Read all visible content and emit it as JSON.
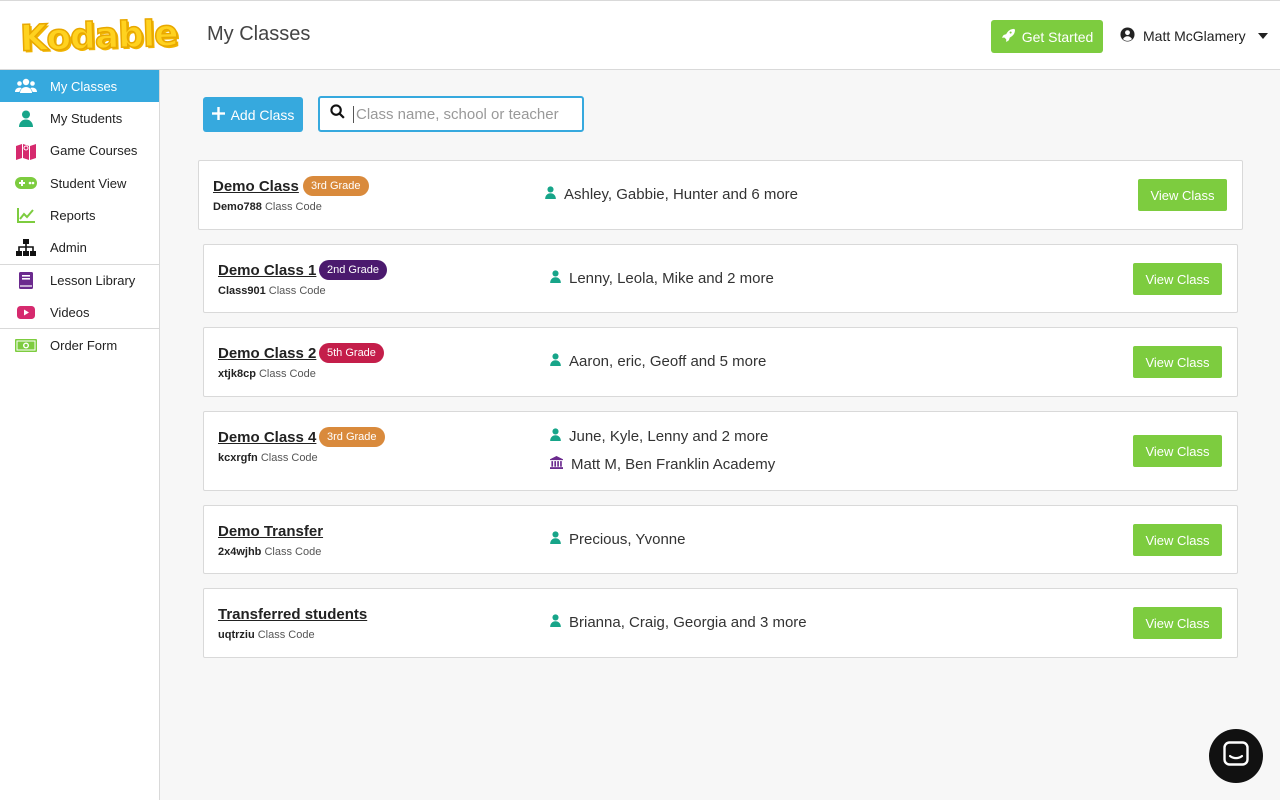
{
  "header": {
    "logo": "Kodable",
    "title": "My Classes",
    "get_started": "Get Started",
    "user_name": "Matt McGlamery"
  },
  "sidebar": {
    "items": [
      {
        "label": "My Classes",
        "icon": "users-icon",
        "active": true
      },
      {
        "label": "My Students",
        "icon": "user-icon"
      },
      {
        "label": "Game Courses",
        "icon": "map-icon"
      },
      {
        "label": "Student View",
        "icon": "gamepad-icon"
      },
      {
        "label": "Reports",
        "icon": "chart-line-icon"
      },
      {
        "label": "Admin",
        "icon": "sitemap-icon"
      },
      {
        "label": "Lesson Library",
        "icon": "book-icon"
      },
      {
        "label": "Videos",
        "icon": "youtube-icon"
      },
      {
        "label": "Order Form",
        "icon": "money-icon"
      }
    ]
  },
  "toolbar": {
    "add_class": "Add Class",
    "search_placeholder": "Class name, school or teacher"
  },
  "classes": [
    {
      "name": "Demo Class",
      "grade": "3rd Grade",
      "code": "Demo788",
      "code_label": "Class Code",
      "students": "Ashley, Gabbie, Hunter and 6 more",
      "button": "View Class"
    },
    {
      "name": "Demo Class 1",
      "grade": "2nd Grade",
      "code": "Class901",
      "code_label": "Class Code",
      "students": "Lenny, Leola, Mike and 2 more",
      "button": "View Class"
    },
    {
      "name": "Demo Class 2",
      "grade": "5th Grade",
      "code": "xtjk8cp",
      "code_label": "Class Code",
      "students": "Aaron, eric, Geoff and 5 more",
      "button": "View Class"
    },
    {
      "name": "Demo Class 4",
      "grade": "3rd Grade",
      "code": "kcxrgfn",
      "code_label": "Class Code",
      "students": "June, Kyle, Lenny and 2 more",
      "school": "Matt M, Ben Franklin Academy",
      "button": "View Class"
    },
    {
      "name": "Demo Transfer",
      "code": "2x4wjhb",
      "code_label": "Class Code",
      "students": "Precious, Yvonne",
      "button": "View Class"
    },
    {
      "name": "Transferred students",
      "code": "uqtrziu",
      "code_label": "Class Code",
      "students": "Brianna, Craig, Georgia and 3 more",
      "button": "View Class"
    }
  ],
  "colors": {
    "accent_blue": "#36a9de",
    "accent_green": "#7dcc3f",
    "grade_3rd": "#d98a3c",
    "grade_2nd": "#4b1a6e",
    "grade_5th": "#c41e4a",
    "teal": "#17a589"
  }
}
